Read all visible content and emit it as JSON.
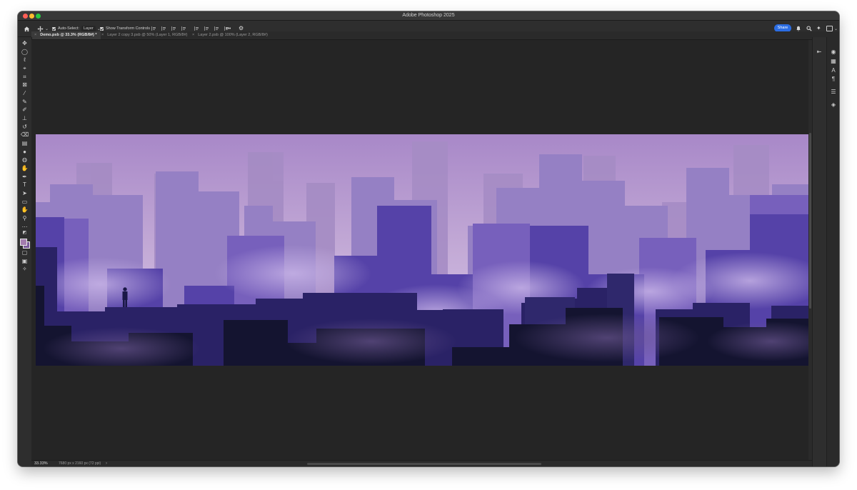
{
  "window": {
    "title": "Adobe Photoshop 2025"
  },
  "options_bar": {
    "home_icon": "home-icon",
    "move_tool_icon": "move-tool-icon",
    "auto_select_label": "Auto-Select:",
    "auto_select_checked": true,
    "auto_select_target": "Layer",
    "show_transform_label": "Show Transform Controls",
    "show_transform_checked": true,
    "more_label": "•••",
    "share_label": "Share"
  },
  "tabs": [
    {
      "label": "Demo.psb @ 33.3% (RGB/8#) *",
      "active": true
    },
    {
      "label": "Layer 2 copy 3.psb @ 50% (Layer 1, RGB/8#)",
      "active": false
    },
    {
      "label": "Layer 2.psb @ 100% (Layer 2, RGB/8#)",
      "active": false
    }
  ],
  "tools": [
    "move-tool-icon",
    "marquee-tool-icon",
    "lasso-tool-icon",
    "object-selection-icon",
    "crop-tool-icon",
    "frame-tool-icon",
    "eyedropper-icon",
    "healing-brush-icon",
    "brush-tool-icon",
    "clone-stamp-icon",
    "history-brush-icon",
    "eraser-icon",
    "gradient-tool-icon",
    "blur-tool-icon",
    "dodge-tool-icon",
    "pen-tool-icon",
    "type-tool-icon",
    "path-selection-icon",
    "rectangle-tool-icon",
    "hand-tool-icon",
    "zoom-tool-icon",
    "more-tools-icon"
  ],
  "colors": {
    "foreground": "#a37dae",
    "background": "#7a5a9a",
    "accent": "#2b6de3",
    "sky_top": "#a888c8",
    "sky_bottom": "#d8c6ea"
  },
  "right_panel_icons": [
    "learn-icon",
    "libraries-icon",
    "character-icon",
    "paragraph-icon",
    "adjustments-icon",
    "layers-icon"
  ],
  "status": {
    "zoom": "33.33%",
    "doc_size": "7680 px x 2160 px (72 ppi)",
    "arrow": "›"
  }
}
